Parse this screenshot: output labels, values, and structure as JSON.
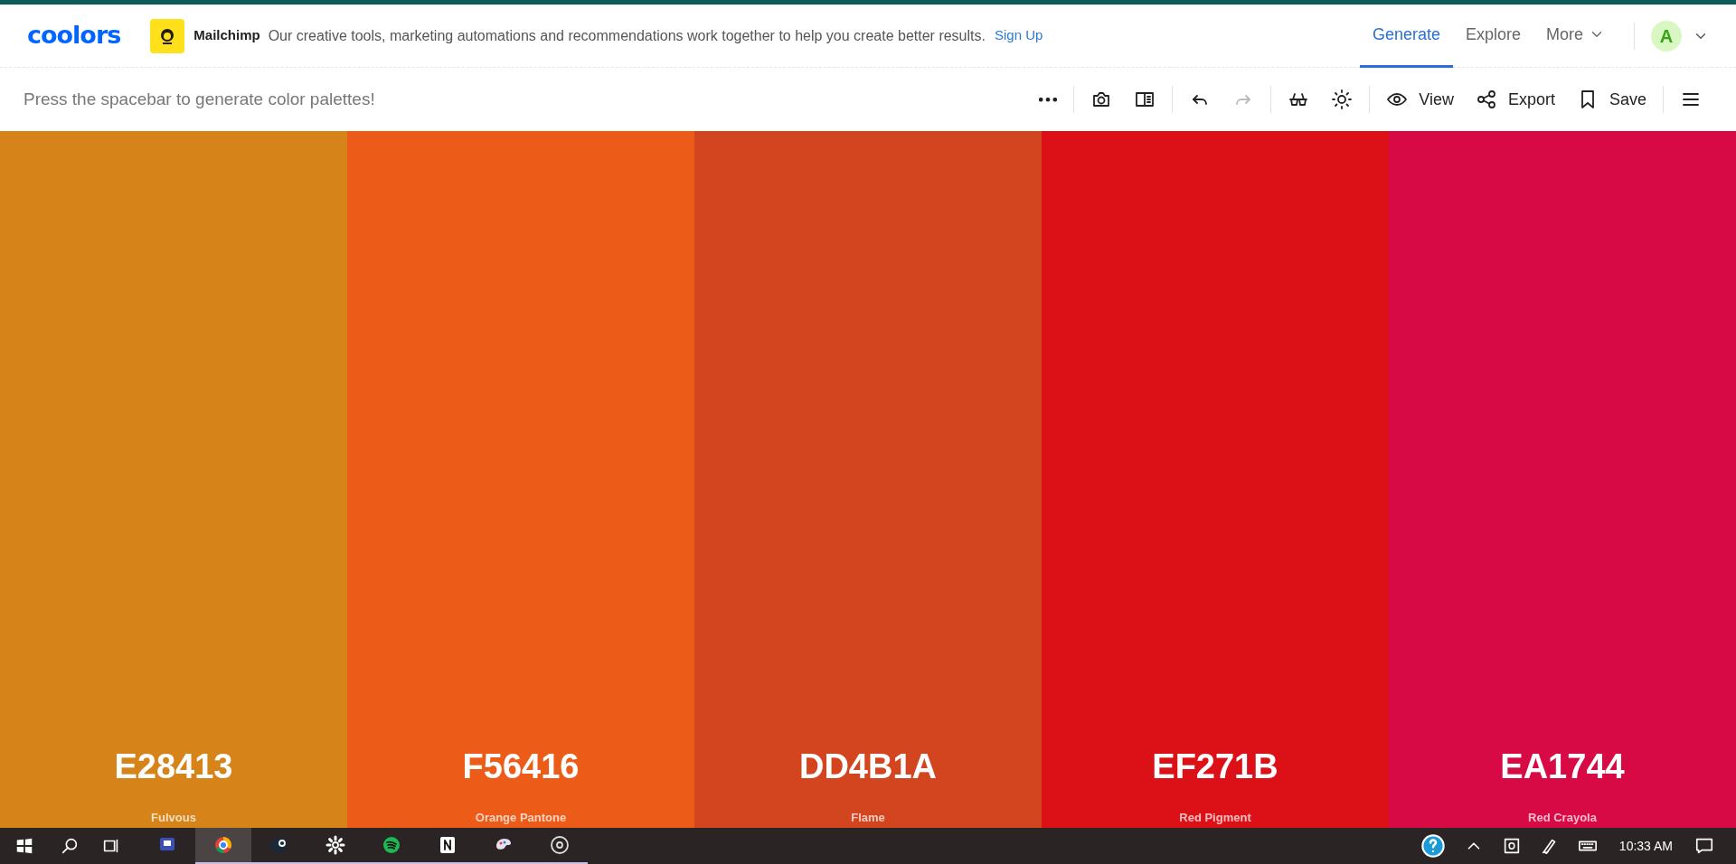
{
  "header": {
    "logo": "coolors",
    "ad": {
      "brand": "Mailchimp",
      "text": "Our creative tools, marketing automations and recommendations work together to help you create better results.",
      "link": "Sign Up"
    },
    "nav": [
      {
        "label": "Generate",
        "selected": true,
        "kind": "link"
      },
      {
        "label": "Explore",
        "selected": false,
        "kind": "link"
      },
      {
        "label": "More",
        "selected": false,
        "kind": "dropdown"
      }
    ],
    "avatar": "A"
  },
  "toolbar": {
    "hint": "Press the spacebar to generate color palettes!",
    "items": [
      {
        "kind": "icon",
        "disabled": false
      },
      {
        "kind": "divider"
      },
      {
        "kind": "icon",
        "disabled": false
      },
      {
        "kind": "icon",
        "disabled": false
      },
      {
        "kind": "divider"
      },
      {
        "kind": "icon",
        "disabled": false
      },
      {
        "kind": "icon",
        "disabled": true
      },
      {
        "kind": "divider"
      },
      {
        "kind": "icon",
        "disabled": false
      },
      {
        "kind": "icon",
        "disabled": false
      },
      {
        "kind": "divider"
      },
      {
        "kind": "labeled",
        "label": "View",
        "disabled": false
      },
      {
        "kind": "labeled",
        "label": "Export",
        "disabled": false
      },
      {
        "kind": "labeled",
        "label": "Save",
        "disabled": false
      },
      {
        "kind": "divider"
      },
      {
        "kind": "icon",
        "disabled": false
      }
    ]
  },
  "palette": [
    {
      "hex": "E28413",
      "name": "Fulvous",
      "color": "#d6841a"
    },
    {
      "hex": "F56416",
      "name": "Orange Pantone",
      "color": "#ec5c18"
    },
    {
      "hex": "DD4B1A",
      "name": "Flame",
      "color": "#d2451f"
    },
    {
      "hex": "EF271B",
      "name": "Red Pigment",
      "color": "#dc1118"
    },
    {
      "hex": "EA1744",
      "name": "Red Crayola",
      "color": "#d80a46"
    }
  ],
  "taskbar": {
    "apps": [
      {
        "selected": false,
        "running": false
      },
      {
        "selected": true,
        "running": true
      },
      {
        "selected": false,
        "running": true
      },
      {
        "selected": false,
        "running": true
      },
      {
        "selected": false,
        "running": true
      },
      {
        "selected": false,
        "running": true
      },
      {
        "selected": false,
        "running": true
      },
      {
        "selected": false,
        "running": true
      }
    ],
    "time": "10:33 AM"
  }
}
